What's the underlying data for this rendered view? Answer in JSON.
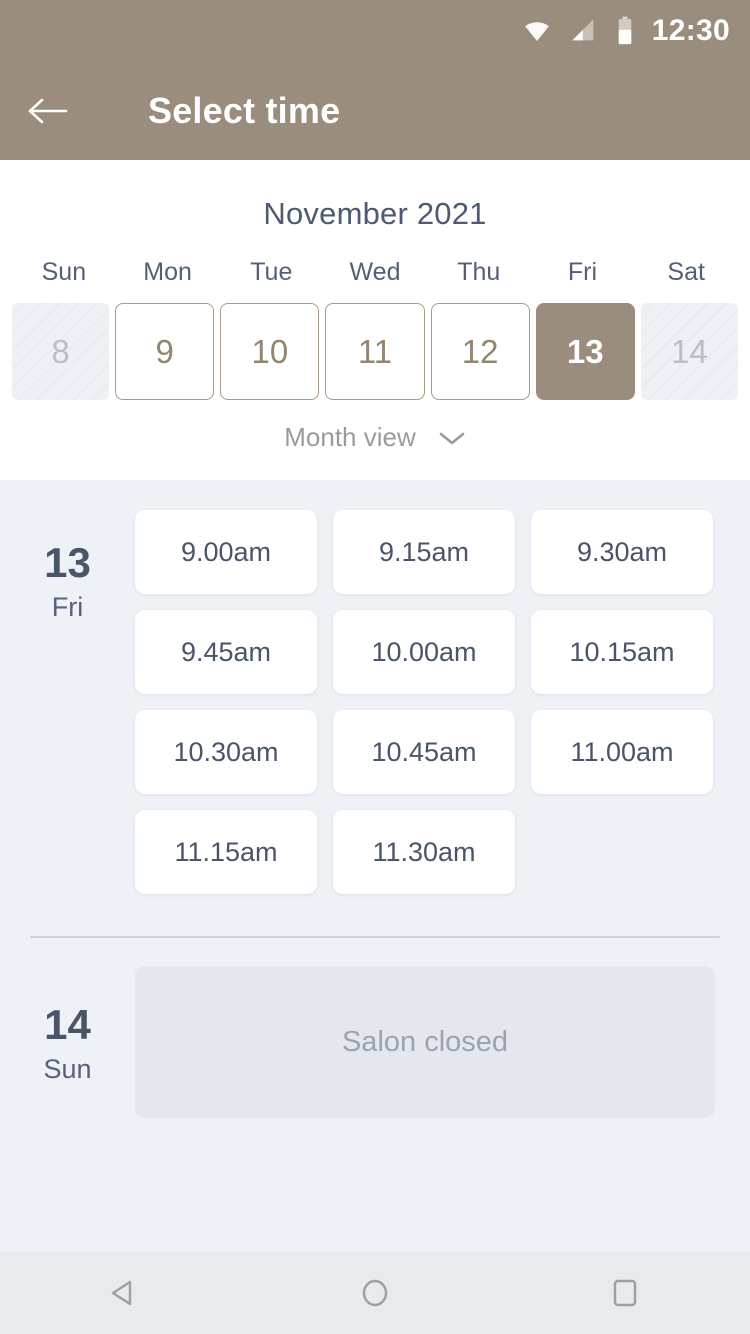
{
  "status_bar": {
    "time": "12:30",
    "icons": [
      "wifi-icon",
      "cell-signal-icon",
      "battery-icon"
    ]
  },
  "app_bar": {
    "back_icon": "back-arrow-icon",
    "title": "Select time"
  },
  "calendar": {
    "month_label": "November 2021",
    "weekdays": [
      "Sun",
      "Mon",
      "Tue",
      "Wed",
      "Thu",
      "Fri",
      "Sat"
    ],
    "days": [
      {
        "number": "8",
        "state": "disabled"
      },
      {
        "number": "9",
        "state": "available"
      },
      {
        "number": "10",
        "state": "available"
      },
      {
        "number": "11",
        "state": "available"
      },
      {
        "number": "12",
        "state": "available"
      },
      {
        "number": "13",
        "state": "selected"
      },
      {
        "number": "14",
        "state": "disabled"
      }
    ],
    "view_toggle": {
      "label": "Month view",
      "icon": "chevron-down-icon"
    }
  },
  "schedule": {
    "groups": [
      {
        "day_number": "13",
        "day_of_week": "Fri",
        "slots": [
          "9.00am",
          "9.15am",
          "9.30am",
          "9.45am",
          "10.00am",
          "10.15am",
          "10.30am",
          "10.45am",
          "11.00am",
          "11.15am",
          "11.30am"
        ]
      },
      {
        "day_number": "14",
        "day_of_week": "Sun",
        "closed_message": "Salon closed"
      }
    ]
  },
  "nav_bar": {
    "back_label": "back-triangle-icon",
    "home_label": "home-circle-icon",
    "recents_label": "recents-square-icon"
  },
  "colors": {
    "header_taupe": "#9a8d7d",
    "slot_bg": "#eef1f6",
    "text_slate": "#4a5568",
    "closed_bg": "#e4e8ee"
  }
}
